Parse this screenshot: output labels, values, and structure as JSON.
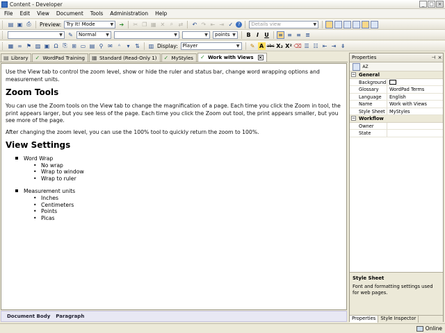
{
  "window": {
    "title": "Content - Developer"
  },
  "menu": [
    "File",
    "Edit",
    "View",
    "Document",
    "Tools",
    "Administration",
    "Help"
  ],
  "toolbar1": {
    "preview_label": "Preview:",
    "preview_mode": "Try It! Mode",
    "view_select": "Details view"
  },
  "toolbar2": {
    "style_select": "Normal",
    "unit_select": "points",
    "bold": "B",
    "italic": "I",
    "underline": "U"
  },
  "toolbar3": {
    "display_label": "Display:",
    "display_select": "Player",
    "abc": "abc",
    "subscript": "X₂",
    "superscript": "X²"
  },
  "tabs": [
    {
      "label": "Library"
    },
    {
      "label": "WordPad Training"
    },
    {
      "label": "Standard (Read-Only 1)"
    },
    {
      "label": "MyStyles"
    },
    {
      "label": "Work with Views"
    }
  ],
  "document": {
    "intro": "Use the View tab to control the zoom level, show or hide the ruler and status bar, change word wrapping options and measurement units.",
    "zoom_heading": "Zoom Tools",
    "zoom_p1": "You can use the Zoom tools on the View tab to change the magnification of a page. Each time you click the Zoom in tool, the print appears larger, but you see less of the page. Each time you click the Zoom out tool, the print appears smaller, but you see more of the page.",
    "zoom_p2": "After changing the zoom level, you can use the 100% tool to quickly return the zoom to 100%.",
    "view_heading": "View Settings",
    "lists": [
      {
        "label": "Word Wrap",
        "items": [
          "No wrap",
          "Wrap to window",
          "Wrap to ruler"
        ]
      },
      {
        "label": "Measurement units",
        "items": [
          "Inches",
          "Centimeters",
          "Points",
          "Picas"
        ]
      }
    ]
  },
  "crumbs": [
    "Document Body",
    "Paragraph"
  ],
  "properties": {
    "header": "Properties",
    "sort_icon": "AZ",
    "categories": [
      {
        "name": "General",
        "rows": [
          {
            "key": "Background ...",
            "value": ""
          },
          {
            "key": "Glossary",
            "value": "WordPad Terms"
          },
          {
            "key": "Language",
            "value": "English"
          },
          {
            "key": "Name",
            "value": "Work with Views"
          },
          {
            "key": "Style Sheet",
            "value": "MyStyles"
          }
        ]
      },
      {
        "name": "Workflow",
        "rows": [
          {
            "key": "Owner",
            "value": ""
          },
          {
            "key": "State",
            "value": ""
          }
        ]
      }
    ],
    "description_title": "Style Sheet",
    "description_text": "Font and formatting settings used for web pages.",
    "tabs": [
      "Properties",
      "Style Inspector"
    ]
  },
  "status": {
    "online": "Online"
  }
}
